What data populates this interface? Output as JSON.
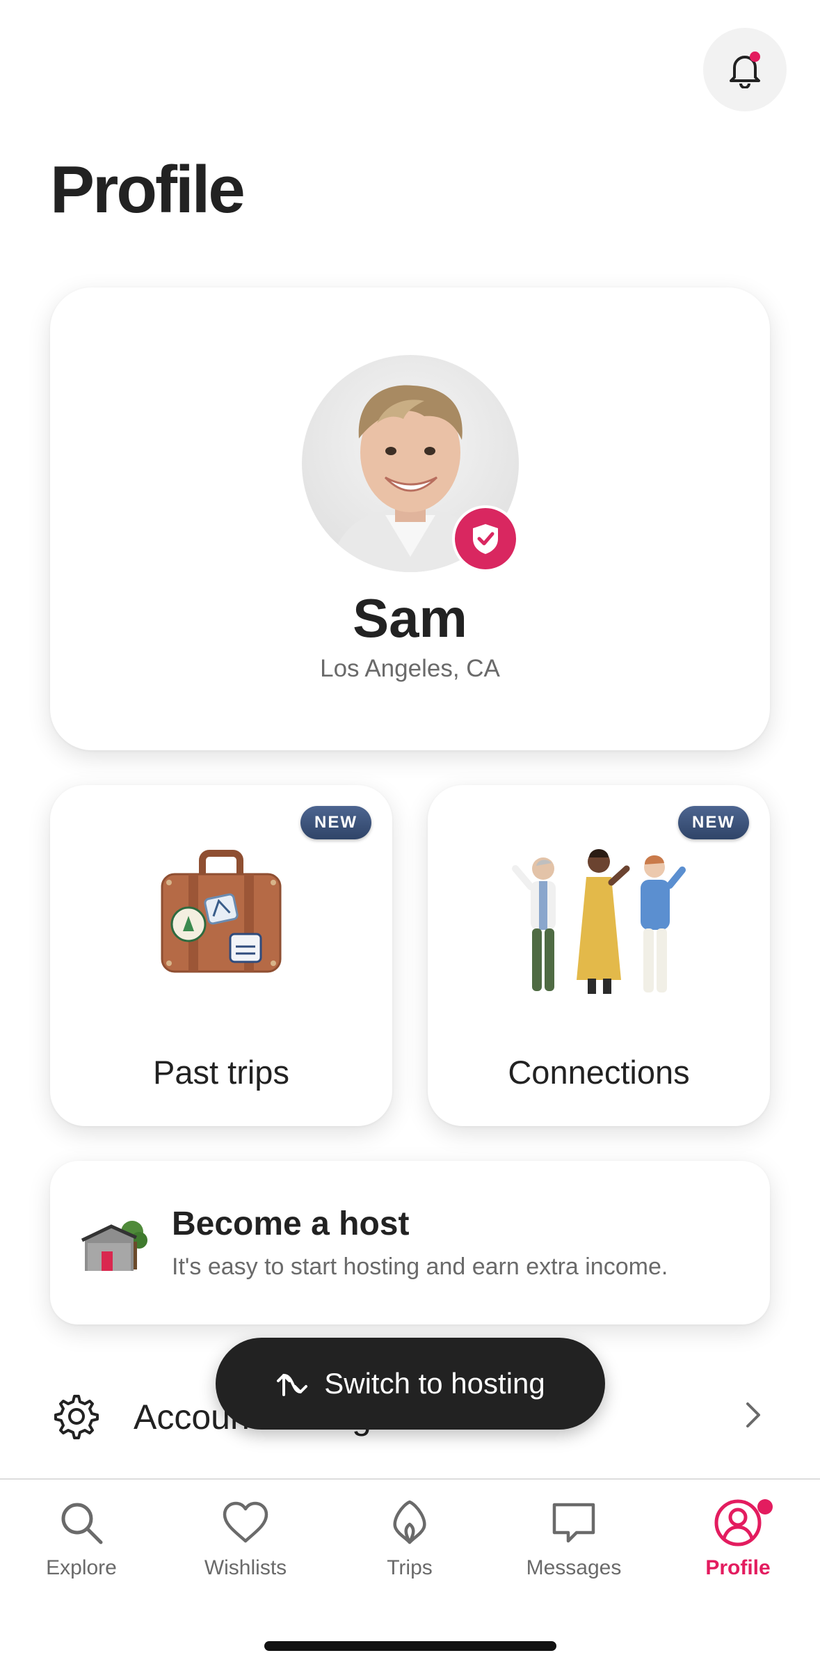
{
  "header": {
    "page_title": "Profile",
    "notification_icon": "bell-icon"
  },
  "profile": {
    "name": "Sam",
    "location": "Los Angeles, CA",
    "verified_icon": "shield-check-icon"
  },
  "tiles": [
    {
      "label": "Past trips",
      "badge": "NEW",
      "icon": "suitcase-icon"
    },
    {
      "label": "Connections",
      "badge": "NEW",
      "icon": "people-icon"
    }
  ],
  "host_promo": {
    "title": "Become a host",
    "subtitle": "It's easy to start hosting and earn extra income.",
    "icon": "house-icon"
  },
  "settings_row": {
    "label": "Account settings",
    "icon": "gear-icon"
  },
  "floating_button": {
    "label": "Switch to hosting",
    "icon": "switch-icon"
  },
  "tabbar": {
    "items": [
      {
        "label": "Explore",
        "icon": "search-icon",
        "active": false
      },
      {
        "label": "Wishlists",
        "icon": "heart-icon",
        "active": false
      },
      {
        "label": "Trips",
        "icon": "airbnb-logo-icon",
        "active": false
      },
      {
        "label": "Messages",
        "icon": "message-icon",
        "active": false
      },
      {
        "label": "Profile",
        "icon": "profile-icon",
        "active": true
      }
    ]
  },
  "colors": {
    "brand": "#e31c5f",
    "text": "#222222",
    "muted": "#6a6a6a",
    "badge": "#3b5179"
  }
}
